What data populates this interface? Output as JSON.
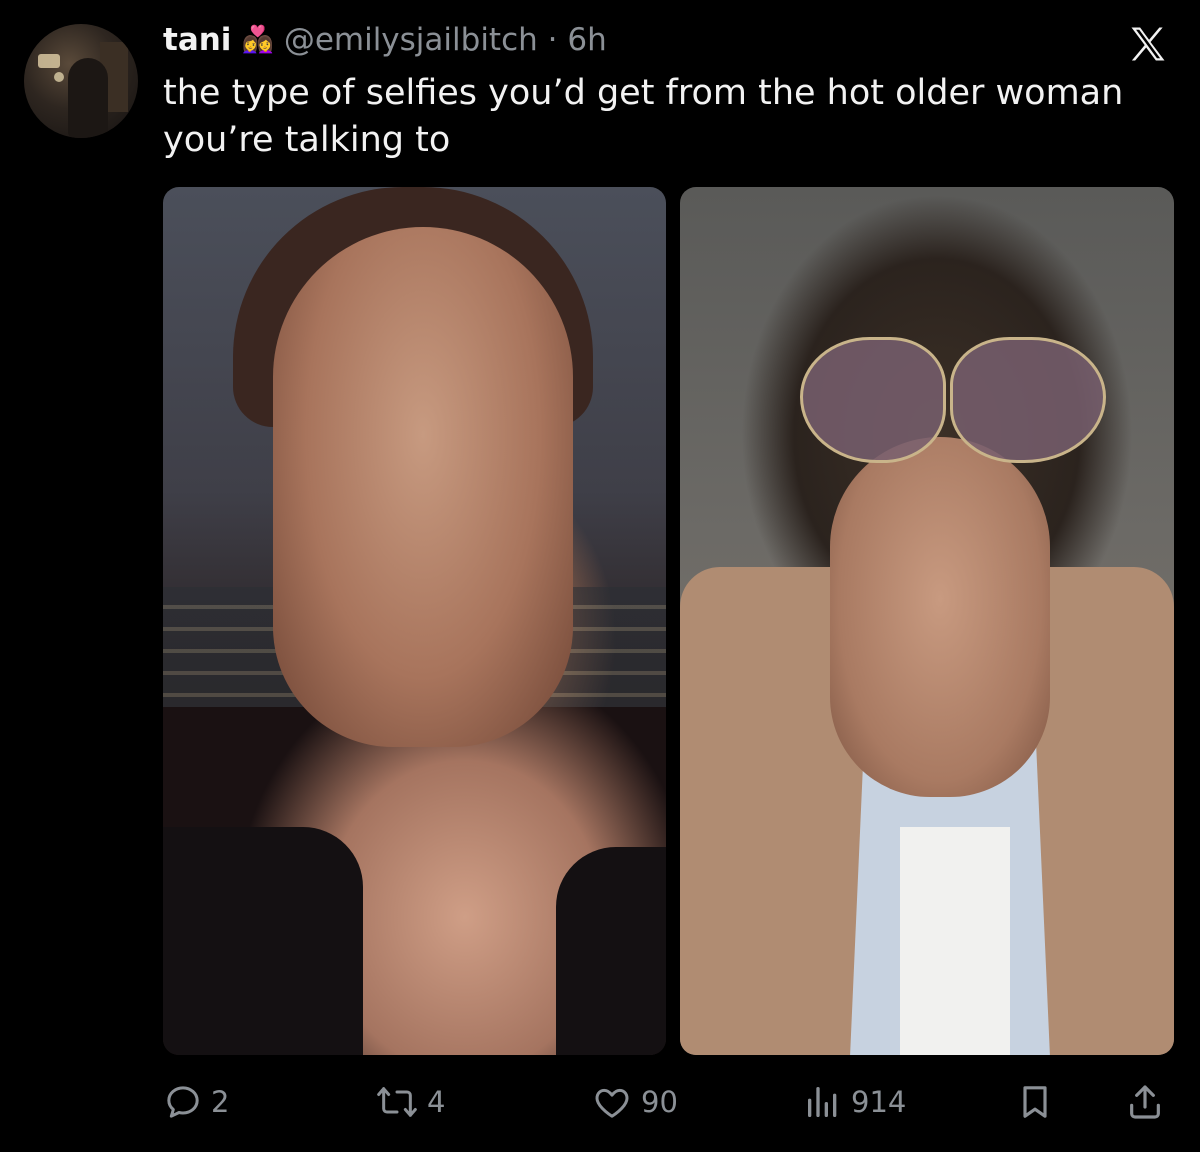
{
  "author": {
    "display_name": "tani",
    "name_emoji": [
      "👩‍❤️‍👩"
    ],
    "handle": "@emilysjailbitch",
    "separator": "·",
    "time": "6h"
  },
  "tweet": {
    "text": "the type of selfies you’d get from the hot older woman you’re talking to"
  },
  "media": [
    {
      "alt": "selfie-1"
    },
    {
      "alt": "selfie-2"
    }
  ],
  "actions": {
    "replies": "2",
    "reposts": "4",
    "likes": "90",
    "views": "914"
  },
  "icons": {
    "brand": "x-logo-icon",
    "reply": "reply-icon",
    "repost": "repost-icon",
    "like": "heart-icon",
    "views": "views-bar-icon",
    "bookmark": "bookmark-icon",
    "share": "share-icon"
  },
  "colors": {
    "background": "#000000",
    "text": "#e7e9ea",
    "secondary": "#8b9096"
  }
}
